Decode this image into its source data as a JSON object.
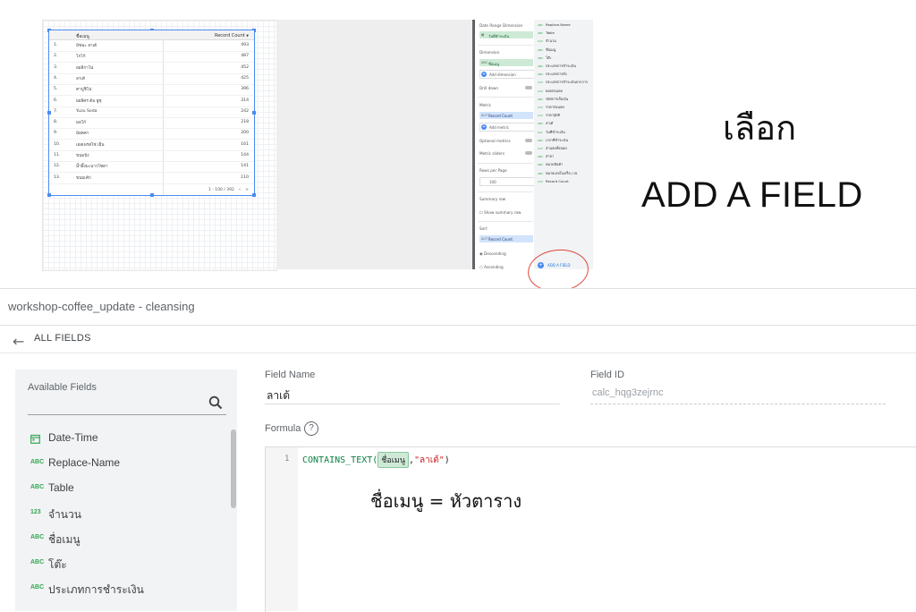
{
  "report_table": {
    "header_dim": "ชื่อเมนู",
    "header_metric": "Record Count",
    "sort_arrow": "▼",
    "rows": [
      {
        "n": "1.",
        "name": "มัชฉะ ลาเต้",
        "v": "493"
      },
      {
        "n": "2.",
        "name": "โกโก้",
        "v": "487"
      },
      {
        "n": "3.",
        "name": "ออลิกาโน่",
        "v": "452"
      },
      {
        "n": "4.",
        "name": "ลาเต้",
        "v": "425"
      },
      {
        "n": "5.",
        "name": "คาปูชิโน่",
        "v": "396"
      },
      {
        "n": "6.",
        "name": "ยอลิคร ต้ม ยูซุ",
        "v": "314"
      },
      {
        "n": "7.",
        "name": "Yuzu Soda",
        "v": "242"
      },
      {
        "n": "8.",
        "name": "มอโก้",
        "v": "218"
      },
      {
        "n": "9.",
        "name": "มัอคคา",
        "v": "200"
      },
      {
        "n": "10.",
        "name": "เอสเพรสโซ่ เย็น",
        "v": "161"
      },
      {
        "n": "11.",
        "name": "ขนมปัง",
        "v": "144"
      },
      {
        "n": "12.",
        "name": "น้ำผึ้งมะนาวโซดา",
        "v": "141"
      },
      {
        "n": "13.",
        "name": "ขนมเค้ก",
        "v": "110"
      }
    ],
    "pager": "1 - 100 / 392",
    "prev": "<",
    "next": ">"
  },
  "props": {
    "date_range_dim": "Date Range Dimension",
    "date_chip": "วันที่ชำระเงิน",
    "dimension": "Dimension",
    "dim_chip": "ชื่อเมนู",
    "add_dimension": "Add dimension",
    "drill_down": "Drill down",
    "metric": "Metric",
    "metric_chip": "Record Count",
    "add_metric": "Add metric",
    "optional_metrics": "Optional metrics",
    "metric_sliders": "Metric sliders",
    "rows_per_page": "Rows per Page",
    "rows_value": "100",
    "summary_row": "Summary row",
    "show_summary": "Show summary row",
    "sort": "Sort",
    "sort_chip": "Record Count",
    "descending": "Descending",
    "ascending": "Ascending",
    "abc": "ABC",
    "aut": "AUT"
  },
  "fields_panel": {
    "items": [
      {
        "t": "ABC",
        "label": "Replace-Name"
      },
      {
        "t": "ABC",
        "label": "Table"
      },
      {
        "t": "123",
        "label": "จำนวน"
      },
      {
        "t": "ABC",
        "label": "ชื่อเมนู"
      },
      {
        "t": "ABC",
        "label": "โต๊ะ"
      },
      {
        "t": "ABC",
        "label": "ประเภทการชำระเงิน"
      },
      {
        "t": "ABC",
        "label": "ประเภทการสั่ง"
      },
      {
        "t": "123",
        "label": "ประเภทการชำระเงินจากการ"
      },
      {
        "t": "123",
        "label": "ยอดก่อนลด"
      },
      {
        "t": "ABC",
        "label": "รหัสการเก็บเงิน"
      },
      {
        "t": "123",
        "label": "ราคาก่อนลด"
      },
      {
        "t": "123",
        "label": "ราคาสุทธิ"
      },
      {
        "t": "ABC",
        "label": "ลาเต้"
      },
      {
        "t": "CAL",
        "label": "วันที่ชำระเงิน"
      },
      {
        "t": "ABC",
        "label": "เวลาที่ชำระเงิน"
      },
      {
        "t": "123",
        "label": "ส่วนลดทั้งหมด"
      },
      {
        "t": "ABC",
        "label": "สาขา"
      },
      {
        "t": "ABC",
        "label": "หมวดสินค้า"
      },
      {
        "t": "ABC",
        "label": "หมายเลขใบเสร็จ / ID"
      },
      {
        "t": "123",
        "label": "Record Count"
      }
    ],
    "add_field": "ADD A FIELD"
  },
  "callout": {
    "thai": "เลือก",
    "english": "ADD A FIELD"
  },
  "editor": {
    "title": "workshop-coffee_update - cleansing",
    "back_label": "ALL FIELDS",
    "available_fields": "Available Fields",
    "fields": [
      {
        "t": "CAL",
        "label": "Date-Time"
      },
      {
        "t": "ABC",
        "label": "Replace-Name"
      },
      {
        "t": "ABC",
        "label": "Table"
      },
      {
        "t": "123",
        "label": "จำนวน"
      },
      {
        "t": "ABC",
        "label": "ชื่อเมนู"
      },
      {
        "t": "ABC",
        "label": "โต๊ะ"
      },
      {
        "t": "ABC",
        "label": "ประเภทการชำระเงิน"
      }
    ],
    "field_name_label": "Field Name",
    "field_name_value": "ลาเต้",
    "field_id_label": "Field ID",
    "field_id_value": "calc_hqg3zejrnc",
    "formula_label": "Formula",
    "line_number": "1",
    "formula_fn": "CONTAINS_TEXT(",
    "formula_field": "ชื่อเมนู",
    "formula_comma": ",",
    "formula_string": "\"ลาเต้\"",
    "formula_close": ")",
    "annotation": "ชื่อเมนู = หัวตาราง"
  },
  "colors": {
    "accent": "#4285f4",
    "field_chip": "#ceead6",
    "metric_chip": "#d2e3fc",
    "annotation_circle": "#e0443a"
  }
}
